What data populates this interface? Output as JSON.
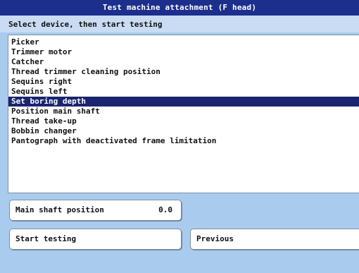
{
  "window": {
    "title": "Test machine attachment (F head)"
  },
  "instruction": "Select device, then start testing",
  "devices": [
    {
      "label": "Picker",
      "selected": false
    },
    {
      "label": "Trimmer motor",
      "selected": false
    },
    {
      "label": "Catcher",
      "selected": false
    },
    {
      "label": "Thread trimmer cleaning position",
      "selected": false
    },
    {
      "label": "Sequins right",
      "selected": false
    },
    {
      "label": "Sequins left",
      "selected": false
    },
    {
      "label": "Set boring depth",
      "selected": true
    },
    {
      "label": "Position main shaft",
      "selected": false
    },
    {
      "label": "Thread take-up",
      "selected": false
    },
    {
      "label": "Bobbin changer",
      "selected": false
    },
    {
      "label": "Pantograph with deactivated frame limitation",
      "selected": false
    }
  ],
  "main_shaft": {
    "label": "Main shaft position",
    "value": "0.0"
  },
  "buttons": {
    "start": "Start testing",
    "previous": "Previous"
  },
  "colors": {
    "background": "#a9cbee",
    "titlebar": "#1c2f8c",
    "selection": "#1a2570"
  }
}
